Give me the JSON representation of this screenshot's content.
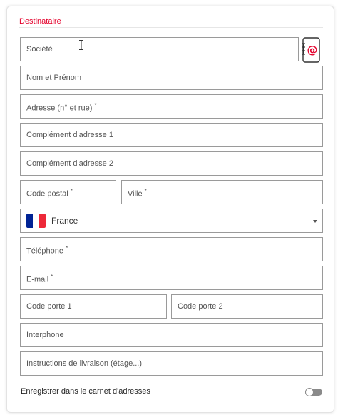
{
  "recipient_form": {
    "section_title": "Destinataire",
    "company": {
      "placeholder": "Société"
    },
    "full_name": {
      "placeholder": "Nom et Prénom"
    },
    "address": {
      "placeholder": "Adresse (n° et rue)",
      "required": "*"
    },
    "address_complement_1": {
      "placeholder": "Complément d'adresse 1"
    },
    "address_complement_2": {
      "placeholder": "Complément d'adresse 2"
    },
    "postal_code": {
      "placeholder": "Code postal",
      "required": "*"
    },
    "city": {
      "placeholder": "Ville",
      "required": "*"
    },
    "country": {
      "selected": "France",
      "flag_colors": [
        "#002395",
        "#ffffff",
        "#ed2939"
      ],
      "icon": "chevron-down-icon"
    },
    "phone": {
      "placeholder": "Téléphone",
      "required": "*"
    },
    "email": {
      "placeholder": "E-mail",
      "required": "*"
    },
    "door_code_1": {
      "placeholder": "Code porte 1"
    },
    "door_code_2": {
      "placeholder": "Code porte 2"
    },
    "intercom": {
      "placeholder": "Interphone"
    },
    "delivery_instructions": {
      "placeholder": "Instructions de livraison (étage...)"
    },
    "save_to_address_book": {
      "label": "Enregistrer dans le carnet d'adresses",
      "enabled": false
    },
    "contacts_button": {
      "icon": "address-book-icon"
    },
    "colors": {
      "accent": "#e4002b",
      "border": "#9a9a9a"
    }
  }
}
